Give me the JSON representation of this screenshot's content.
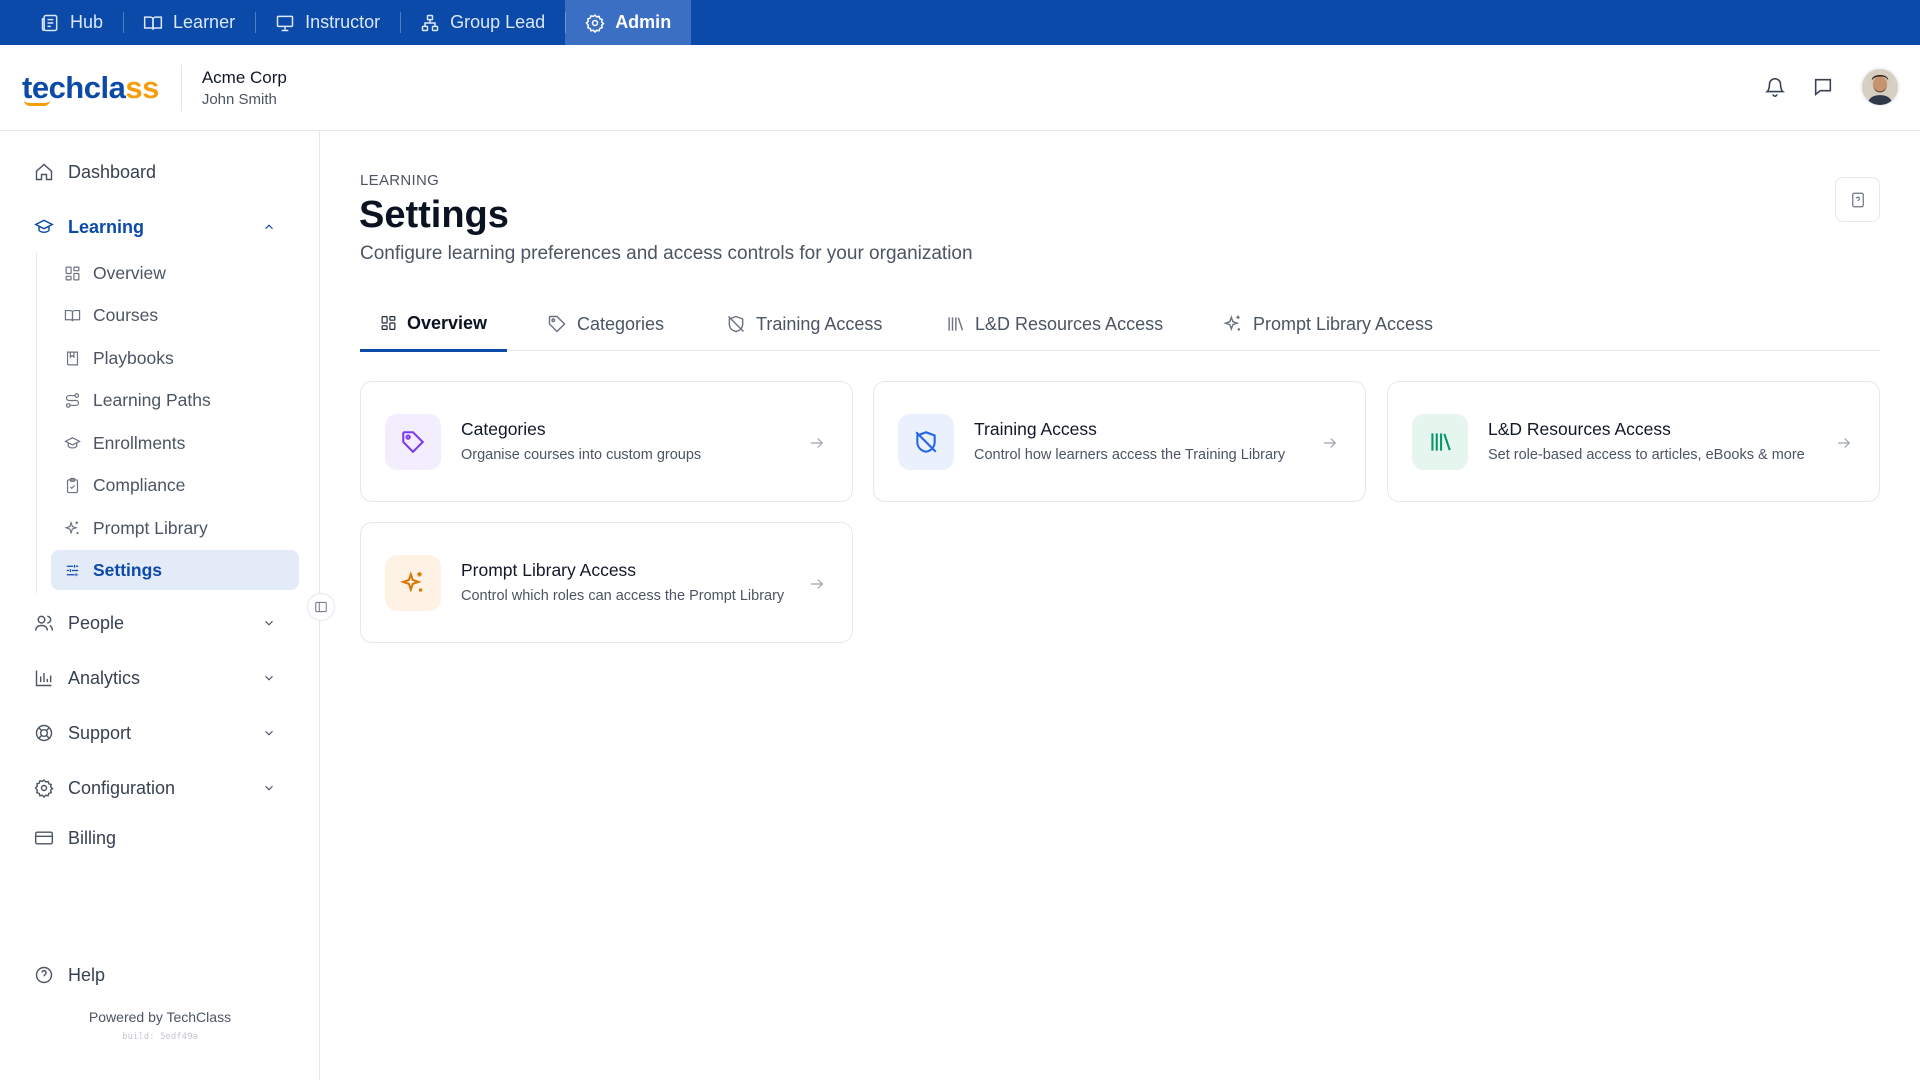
{
  "roles": [
    {
      "label": "Hub",
      "icon": "news-icon"
    },
    {
      "label": "Learner",
      "icon": "book-open-icon"
    },
    {
      "label": "Instructor",
      "icon": "presentation-icon"
    },
    {
      "label": "Group Lead",
      "icon": "org-chart-icon"
    },
    {
      "label": "Admin",
      "icon": "gear-icon",
      "active": true
    }
  ],
  "brand": {
    "logo_main": "techcla",
    "logo_accent": "ss",
    "primary_color": "#0b4aa8",
    "accent_color": "#f59e0b"
  },
  "org": {
    "name": "Acme Corp",
    "user": "John Smith"
  },
  "sidebar": {
    "dashboard": "Dashboard",
    "learning": "Learning",
    "learning_items": [
      {
        "label": "Overview",
        "icon": "grid-icon"
      },
      {
        "label": "Courses",
        "icon": "book-open-icon"
      },
      {
        "label": "Playbooks",
        "icon": "bookmark-book-icon"
      },
      {
        "label": "Learning Paths",
        "icon": "route-icon"
      },
      {
        "label": "Enrollments",
        "icon": "graduation-cap-icon"
      },
      {
        "label": "Compliance",
        "icon": "clipboard-check-icon"
      },
      {
        "label": "Prompt Library",
        "icon": "sparkles-icon"
      },
      {
        "label": "Settings",
        "icon": "sliders-icon",
        "active": true
      }
    ],
    "people": "People",
    "analytics": "Analytics",
    "support": "Support",
    "configuration": "Configuration",
    "billing": "Billing",
    "help": "Help",
    "powered_by": "Powered by TechClass",
    "build": "build: 5edf49a"
  },
  "page": {
    "eyebrow": "LEARNING",
    "title": "Settings",
    "subtitle": "Configure learning preferences and access controls for your organization"
  },
  "tabs": [
    {
      "label": "Overview",
      "icon": "grid-icon",
      "active": true
    },
    {
      "label": "Categories",
      "icon": "tag-icon"
    },
    {
      "label": "Training Access",
      "icon": "shield-off-icon"
    },
    {
      "label": "L&D Resources Access",
      "icon": "library-icon"
    },
    {
      "label": "Prompt Library Access",
      "icon": "sparkles-icon"
    }
  ],
  "cards": [
    {
      "title": "Categories",
      "desc": "Organise courses into custom groups",
      "icon": "tag-icon",
      "icon_color": "#7c3aed",
      "icon_bg": "#f3eefe"
    },
    {
      "title": "Training Access",
      "desc": "Control how learners access the Training Library",
      "icon": "shield-off-icon",
      "icon_color": "#2563eb",
      "icon_bg": "#eaf1fd"
    },
    {
      "title": "L&D Resources Access",
      "desc": "Set role-based access to articles, eBooks & more",
      "icon": "library-icon",
      "icon_color": "#059669",
      "icon_bg": "#e6f6ef"
    },
    {
      "title": "Prompt Library Access",
      "desc": "Control which roles can access the Prompt Library",
      "icon": "sparkles-icon",
      "icon_color": "#d97706",
      "icon_bg": "#fdf2e3"
    }
  ]
}
